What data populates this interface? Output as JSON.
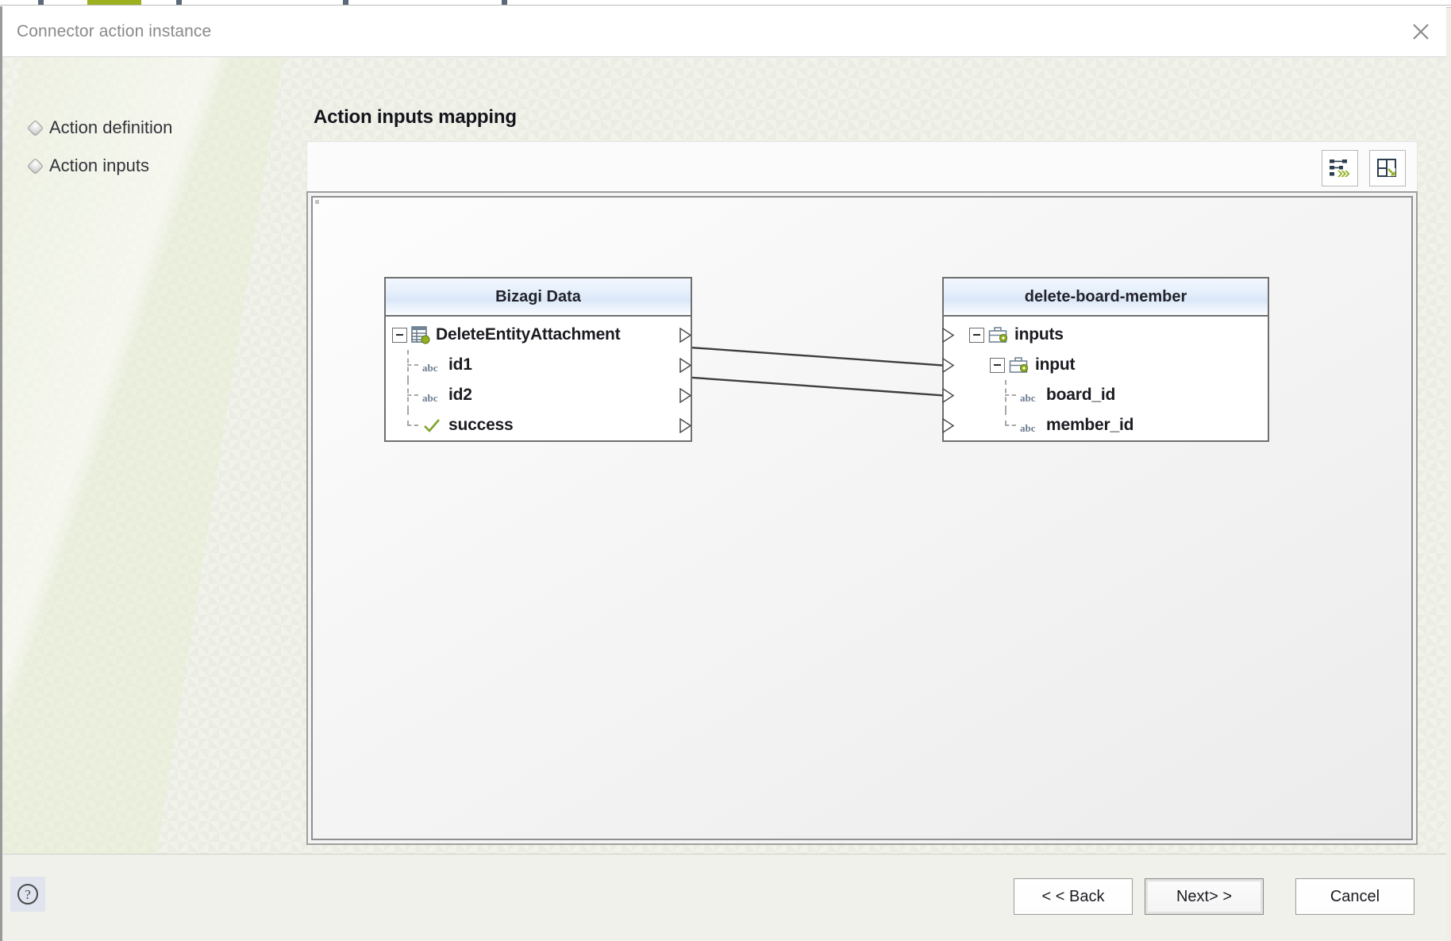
{
  "window": {
    "title": "Connector action instance",
    "close_icon": "close-icon"
  },
  "sidebar": {
    "items": [
      {
        "label": "Action definition",
        "bullet_icon": "diamond-bullet-icon"
      },
      {
        "label": "Action inputs",
        "bullet_icon": "diamond-bullet-icon"
      }
    ]
  },
  "main": {
    "page_title": "Action inputs mapping",
    "toolbar": {
      "buttons": [
        {
          "name": "auto-map-button",
          "icon": "auto-map-icon",
          "tooltip": "Auto map"
        },
        {
          "name": "fit-layout-button",
          "icon": "fit-layout-icon",
          "tooltip": "Fit layout"
        }
      ]
    },
    "mapping": {
      "source_panel": {
        "title": "Bizagi Data",
        "nodes": [
          {
            "label": "DeleteEntityAttachment",
            "icon": "entity-icon",
            "expander": "minus",
            "level": 0,
            "port": "right"
          },
          {
            "label": "id1",
            "icon": "abc-string-icon",
            "level": 1,
            "port": "right"
          },
          {
            "label": "id2",
            "icon": "abc-string-icon",
            "level": 1,
            "port": "right"
          },
          {
            "label": "success",
            "icon": "check-boolean-icon",
            "level": 1,
            "port": "right"
          }
        ]
      },
      "target_panel": {
        "title": "delete-board-member",
        "nodes": [
          {
            "label": "inputs",
            "icon": "briefcase-icon",
            "expander": "minus",
            "level": 0,
            "port": "left"
          },
          {
            "label": "input",
            "icon": "briefcase-icon",
            "expander": "minus",
            "level": 1,
            "port": "left"
          },
          {
            "label": "board_id",
            "icon": "abc-string-icon",
            "level": 2,
            "port": "left"
          },
          {
            "label": "member_id",
            "icon": "abc-string-icon",
            "level": 2,
            "port": "left"
          }
        ]
      },
      "links": [
        {
          "from": "id1",
          "to": "board_id"
        },
        {
          "from": "id2",
          "to": "member_id"
        }
      ]
    }
  },
  "footer": {
    "help_icon": "question-mark-icon",
    "back_label": "< < Back",
    "next_label": "Next> >",
    "cancel_label": "Cancel"
  },
  "colors": {
    "accent_green": "#8fa830",
    "panel_header": "#dae7f8",
    "panel_border": "#6f6f6f",
    "link_line": "#3d3d3d",
    "title_text": "#8a8a8a"
  }
}
